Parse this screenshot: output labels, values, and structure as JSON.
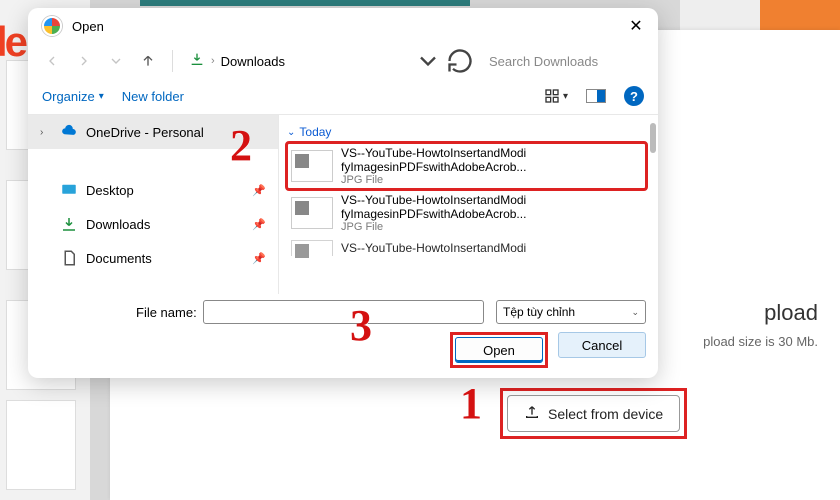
{
  "background": {
    "partial_text": "le",
    "heading_suffix": "pload",
    "sub_suffix": "pload size is 30 Mb.",
    "select_button_label": "Select from device"
  },
  "dialog": {
    "title": "Open",
    "nav": {
      "path_label": "Downloads",
      "search_placeholder": "Search Downloads"
    },
    "toolbar": {
      "organize_label": "Organize",
      "newfolder_label": "New folder",
      "help_glyph": "?"
    },
    "tree": {
      "items": [
        {
          "name": "onedrive",
          "label": "OneDrive - Personal",
          "selected": true,
          "expandable": true,
          "pin": false
        },
        {
          "name": "desktop",
          "label": "Desktop",
          "pin": true
        },
        {
          "name": "downloads",
          "label": "Downloads",
          "pin": true
        },
        {
          "name": "documents",
          "label": "Documents",
          "pin": true
        }
      ]
    },
    "pane": {
      "group_label": "Today",
      "files": [
        {
          "name_line1": "VS--YouTube-HowtoInsertandModi",
          "name_line2": "fyImagesinPDFswithAdobeAcrob...",
          "type_label": "JPG File",
          "highlighted": true
        },
        {
          "name_line1": "VS--YouTube-HowtoInsertandModi",
          "name_line2": "fyImagesinPDFswithAdobeAcrob...",
          "type_label": "JPG File",
          "highlighted": false
        },
        {
          "name_line1": "VS--YouTube-HowtoInsertandModi",
          "name_line2": "",
          "type_label": "",
          "highlighted": false
        }
      ]
    },
    "footer": {
      "filename_label": "File name:",
      "filename_value": "",
      "filetype_label": "Tệp tùy chỉnh",
      "open_label": "Open",
      "cancel_label": "Cancel"
    }
  },
  "annotations": {
    "step1": "1",
    "step2": "2",
    "step3": "3"
  }
}
